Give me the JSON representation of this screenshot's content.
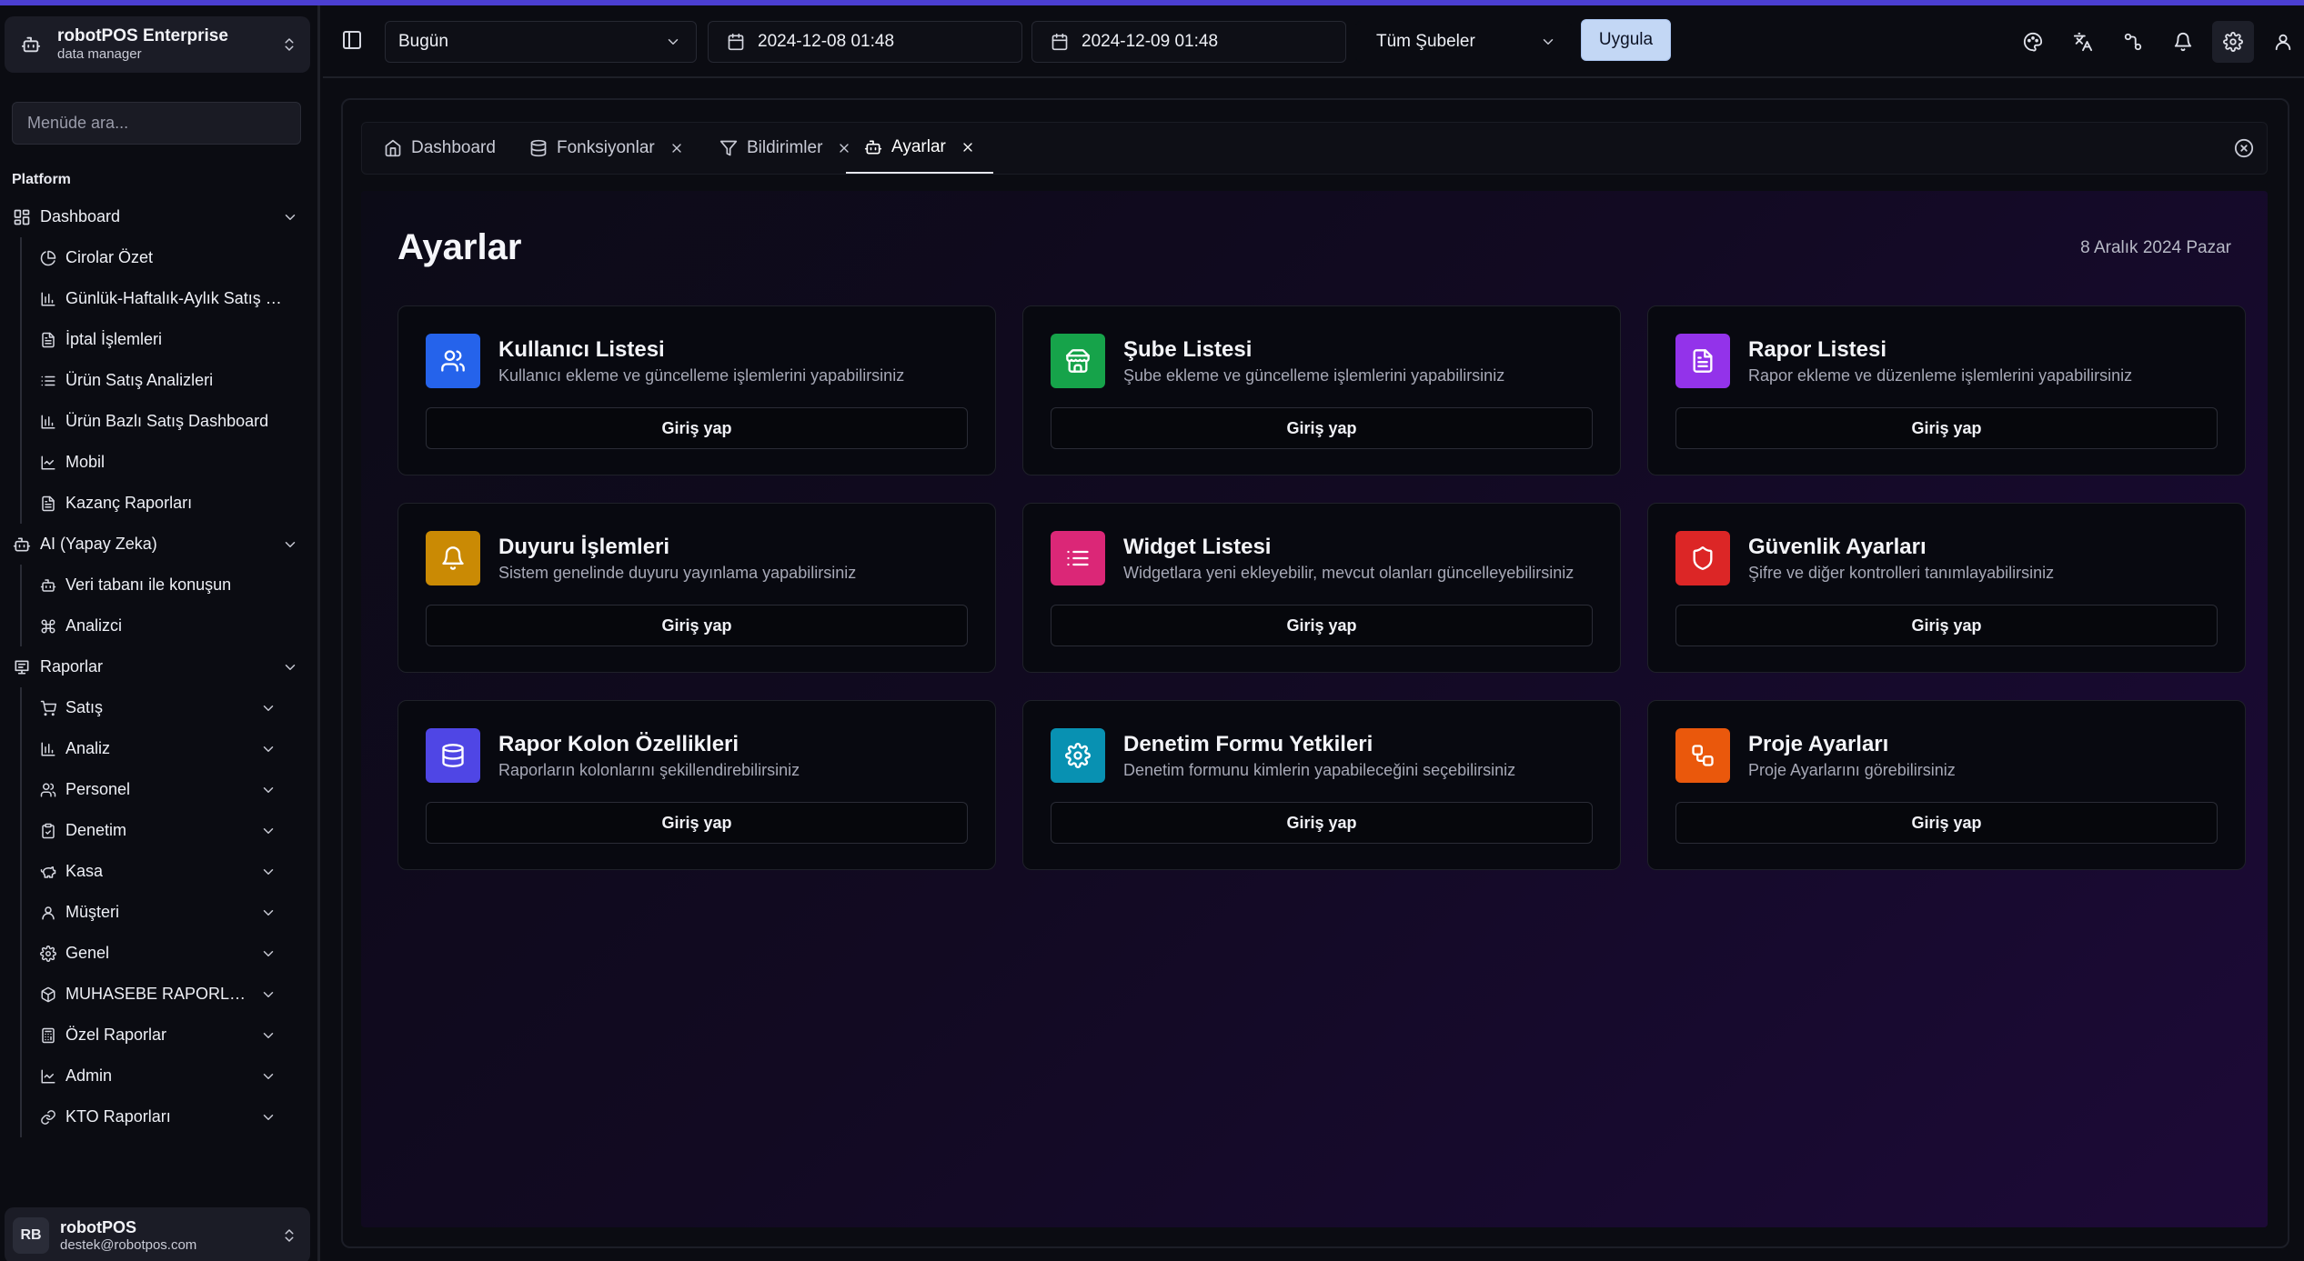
{
  "brand": {
    "title": "robotPOS Enterprise",
    "subtitle": "data manager"
  },
  "sidebar": {
    "search_placeholder": "Menüde ara...",
    "section_label": "Platform",
    "groups": [
      {
        "label": "Dashboard",
        "items": [
          {
            "label": "Cirolar Özet",
            "icon": "chart-pie-icon"
          },
          {
            "label": "Günlük-Haftalık-Aylık Satış Raporları",
            "icon": "bar-chart-icon"
          },
          {
            "label": "İptal İşlemleri",
            "icon": "document-icon"
          },
          {
            "label": "Ürün Satış Analizleri",
            "icon": "list-icon"
          },
          {
            "label": "Ürün Bazlı Satış Dashboard",
            "icon": "bar-chart-icon"
          },
          {
            "label": "Mobil",
            "icon": "line-chart-icon"
          },
          {
            "label": "Kazanç Raporları",
            "icon": "document-icon"
          }
        ]
      },
      {
        "label": "AI (Yapay Zeka)",
        "items": [
          {
            "label": "Veri tabanı ile konuşun",
            "icon": "bot-icon"
          },
          {
            "label": "Analizci",
            "icon": "command-icon"
          }
        ]
      },
      {
        "label": "Raporlar",
        "items": [
          {
            "label": "Satış",
            "icon": "cart-icon"
          },
          {
            "label": "Analiz",
            "icon": "bar-chart-icon"
          },
          {
            "label": "Personel",
            "icon": "users-icon"
          },
          {
            "label": "Denetim",
            "icon": "clipboard-icon"
          },
          {
            "label": "Kasa",
            "icon": "piggy-bank-icon"
          },
          {
            "label": "Müşteri",
            "icon": "user-icon"
          },
          {
            "label": "Genel",
            "icon": "gear-icon"
          },
          {
            "label": "MUHASEBE RAPORLARI",
            "icon": "box-icon"
          },
          {
            "label": "Özel Raporlar",
            "icon": "calculator-icon"
          },
          {
            "label": "Admin",
            "icon": "line-chart-icon"
          },
          {
            "label": "KTO Raporları",
            "icon": "link-icon"
          }
        ]
      }
    ]
  },
  "user": {
    "initials": "RB",
    "name": "robotPOS",
    "email": "destek@robotpos.com"
  },
  "topbar": {
    "period": "Bugün",
    "start_date": "2024-12-08 01:48",
    "end_date": "2024-12-09 01:48",
    "branch": "Tüm Şubeler",
    "apply_label": "Uygula"
  },
  "tabs": [
    {
      "label": "Dashboard",
      "icon": "home-icon",
      "closable": false
    },
    {
      "label": "Fonksiyonlar",
      "icon": "database-icon",
      "closable": true
    },
    {
      "label": "Bildirimler",
      "icon": "filter-icon",
      "closable": true
    },
    {
      "label": "Ayarlar",
      "icon": "bot-icon",
      "closable": true,
      "active": true
    }
  ],
  "page": {
    "title": "Ayarlar",
    "date": "8 Aralık 2024 Pazar"
  },
  "cards": [
    {
      "title": "Kullanıcı Listesi",
      "desc": "Kullanıcı ekleme ve güncelleme işlemlerini yapabilirsiniz",
      "button": "Giriş yap",
      "color": "#2563eb",
      "icon": "users-icon"
    },
    {
      "title": "Şube Listesi",
      "desc": "Şube ekleme ve güncelleme işlemlerini yapabilirsiniz",
      "button": "Giriş yap",
      "color": "#16a34a",
      "icon": "store-icon"
    },
    {
      "title": "Rapor Listesi",
      "desc": "Rapor ekleme ve düzenleme işlemlerini yapabilirsiniz",
      "button": "Giriş yap",
      "color": "#9333ea",
      "icon": "document-icon"
    },
    {
      "title": "Duyuru İşlemleri",
      "desc": "Sistem genelinde duyuru yayınlama yapabilirsiniz",
      "button": "Giriş yap",
      "color": "#ca8a04",
      "icon": "bell-icon"
    },
    {
      "title": "Widget Listesi",
      "desc": "Widgetlara yeni ekleyebilir, mevcut olanları güncelleyebilirsiniz",
      "button": "Giriş yap",
      "color": "#db2777",
      "icon": "list-icon"
    },
    {
      "title": "Güvenlik Ayarları",
      "desc": "Şifre ve diğer kontrolleri tanımlayabilirsiniz",
      "button": "Giriş yap",
      "color": "#dc2626",
      "icon": "shield-icon"
    },
    {
      "title": "Rapor Kolon Özellikleri",
      "desc": "Raporların kolonlarını şekillendirebilirsiniz",
      "button": "Giriş yap",
      "color": "#4f46e5",
      "icon": "database-icon"
    },
    {
      "title": "Denetim Formu Yetkileri",
      "desc": "Denetim formunu kimlerin yapabileceğini seçebilirsiniz",
      "button": "Giriş yap",
      "color": "#0891b2",
      "icon": "gear-icon"
    },
    {
      "title": "Proje Ayarları",
      "desc": "Proje Ayarlarını görebilirsiniz",
      "button": "Giriş yap",
      "color": "#ea580c",
      "icon": "workflow-icon"
    }
  ]
}
